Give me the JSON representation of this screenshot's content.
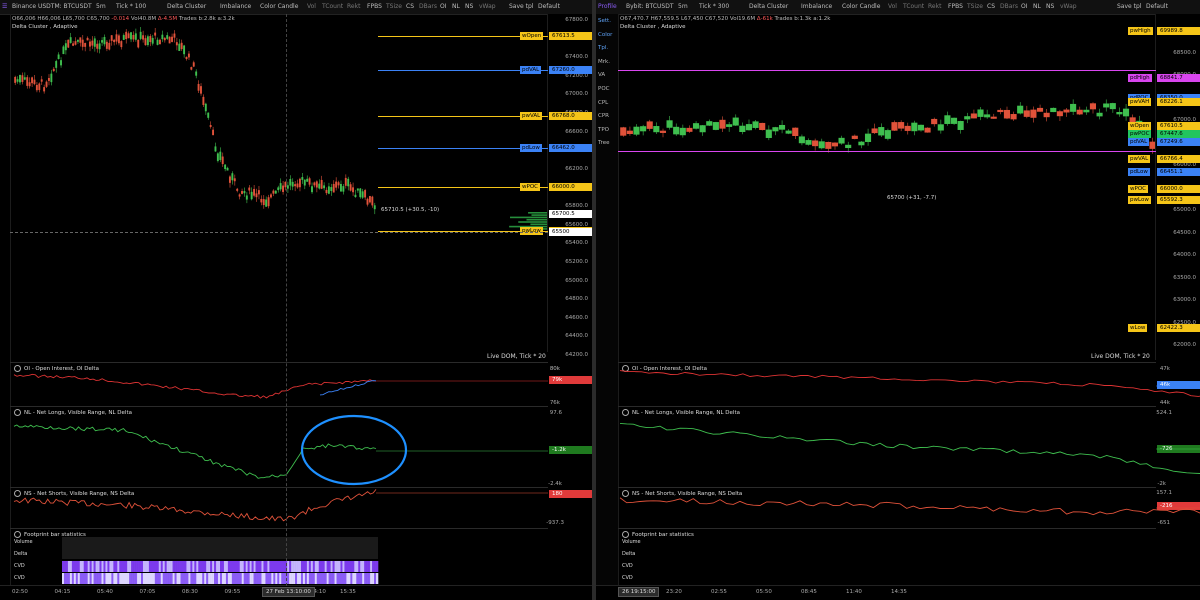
{
  "left": {
    "toolbar": {
      "symbol": "Binance USDTM: BTCUSDT",
      "timeframe": "5m",
      "tick": "Tick * 100",
      "cluster": "Delta Cluster",
      "imbalance": "Imbalance",
      "candle": "Color Candle",
      "items": [
        "Vol",
        "TCount",
        "Rekt",
        "FPBS",
        "TSize",
        "CS",
        "DBars",
        "OI",
        "NL",
        "NS",
        "vWap"
      ],
      "save": "Save tpl",
      "default": "Default"
    },
    "ohlc": {
      "o": "O66,006",
      "h": "H66,006",
      "l": "L65,700",
      "c": "C65,700",
      "chg": "-0.014",
      "vol": "Vol40.8M",
      "d": "Δ-4.5M",
      "trades": "Trades b:2.8k a:3.2k"
    },
    "subtitle": "Delta Cluster , Adaptive",
    "price_ticks": [
      "67800.0",
      "67600.0",
      "67400.0",
      "67200.0",
      "67000.0",
      "66800.0",
      "66600.0",
      "66400.0",
      "66200.0",
      "66000.0",
      "65800.0",
      "65600.0",
      "65400.0",
      "65200.0",
      "65000.0",
      "64800.0",
      "64600.0",
      "64400.0",
      "64200.0"
    ],
    "levels": [
      {
        "label": "wOpen",
        "value": "67613.5",
        "color": "#f5c518"
      },
      {
        "label": "pdVAL",
        "value": "67260.0",
        "color": "#3b82f6"
      },
      {
        "label": "pwVAL",
        "value": "66768.0",
        "color": "#f5c518"
      },
      {
        "label": "pdLow",
        "value": "66462.0",
        "color": "#3b82f6"
      },
      {
        "label": "wPOC",
        "value": "66000.0",
        "color": "#f5c518"
      },
      {
        "label": "pwLow",
        "value": "65500",
        "color": "#f5c518"
      }
    ],
    "current_price": "65700.5",
    "current_note": "65710.5 (+30.5, -10)",
    "crosshair_price": "65500",
    "live_dom": "Live DOM, Tick * 20",
    "oi": {
      "title": "OI - Open Interest, OI Delta",
      "top": "80k",
      "value": "79k",
      "bottom": "76k"
    },
    "nl": {
      "title": "NL - Net Longs, Visible Range, NL Delta",
      "top": "97.6",
      "value": "-1.2k",
      "bottom": "-2.4k"
    },
    "ns": {
      "title": "NS - Net Shorts, Visible Range, NS Delta",
      "top": "180",
      "bottom": "-937.3"
    },
    "fp": {
      "title": "Footprint bar statistics",
      "rows": [
        "Volume",
        "Delta",
        "CVD",
        "CVD"
      ]
    },
    "time_labels": [
      "02:50",
      "04:15",
      "05:40",
      "07:05",
      "08:30",
      "09:55",
      "11:20",
      "14:10",
      "15:35"
    ],
    "time_cursor": "27 Feb 13:10:00"
  },
  "right": {
    "toolbar": {
      "profile": "Profile",
      "symbol": "Bybit: BTCUSDT",
      "timeframe": "5m",
      "tick": "Tick * 300",
      "cluster": "Delta Cluster",
      "imbalance": "Imbalance",
      "candle": "Color Candle",
      "items": [
        "Vol",
        "TCount",
        "Rekt",
        "FPBS",
        "TSize",
        "CS",
        "DBars",
        "OI",
        "NL",
        "NS",
        "vWap"
      ],
      "save": "Save tpl",
      "default": "Default"
    },
    "side": [
      "Sett.",
      "Color",
      "Tpl.",
      "Mrk.",
      "VA",
      "POC",
      "CPL",
      "CPR",
      "TPO",
      "Tree"
    ],
    "ohlc": {
      "o": "O67,470.7",
      "h": "H67,559.5",
      "l": "L67,450",
      "c": "C67,520",
      "vol": "Vol19.6M",
      "d": "Δ-61k",
      "trades": "Trades b:1.3k a:1.2k"
    },
    "subtitle": "Delta Cluster , Adaptive",
    "price_ticks": [
      "69000.0",
      "68500.0",
      "68000.0",
      "67500.0",
      "67000.0",
      "66500.0",
      "66000.0",
      "65500.0",
      "65000.0",
      "64500.0",
      "64000.0",
      "63500.0",
      "63000.0",
      "62500.0",
      "62000.0"
    ],
    "levels": [
      {
        "label": "pwHigh",
        "value": "69989.8",
        "color": "#f5c518"
      },
      {
        "label": "pdHigh",
        "value": "68841.7",
        "color": "#d946ef"
      },
      {
        "label": "pdPOC",
        "value": "68350.0",
        "color": "#3b82f6"
      },
      {
        "label": "pwVAH",
        "value": "68226.1",
        "color": "#f5c518"
      },
      {
        "label": "wOpen",
        "value": "67610.5",
        "color": "#f5c518"
      },
      {
        "label": "pwPOC",
        "value": "67447.6",
        "color": "#22c55e"
      },
      {
        "label": "pdVAL",
        "value": "67249.6",
        "color": "#3b82f6"
      },
      {
        "label": "pwVAL",
        "value": "66766.4",
        "color": "#f5c518"
      },
      {
        "label": "pdLow",
        "value": "66451.1",
        "color": "#3b82f6"
      },
      {
        "label": "wPOC",
        "value": "66000.0",
        "color": "#f5c518"
      },
      {
        "label": "pwLow",
        "value": "65592.3",
        "color": "#f5c518"
      },
      {
        "label": "wLow",
        "value": "62422.3",
        "color": "#f5c518"
      }
    ],
    "current_note": "65700 (+31, -7.7)",
    "live_dom": "Live DOM, Tick * 20",
    "oi": {
      "title": "OI - Open Interest, OI Delta",
      "top": "47k",
      "value": "46k",
      "bottom": "44k"
    },
    "nl": {
      "title": "NL - Net Longs, Visible Range, NL Delta",
      "top": "524.1",
      "value": "-726",
      "bottom": "-2k"
    },
    "ns": {
      "title": "NS - Net Shorts, Visible Range, NS Delta",
      "top": "157.1",
      "value": "-216",
      "bottom": "-651"
    },
    "fp": {
      "title": "Footprint bar statistics",
      "rows": [
        "Volume",
        "Delta",
        "CVD",
        "CVD"
      ]
    },
    "time_labels": [
      "23:20",
      "02:55",
      "05:50",
      "08:45",
      "11:40",
      "14:35"
    ],
    "time_cursor": "26 19:15:00"
  },
  "colors": {
    "up": "#3fbf4f",
    "down": "#e0523a",
    "annotation": "#1e90ff"
  }
}
